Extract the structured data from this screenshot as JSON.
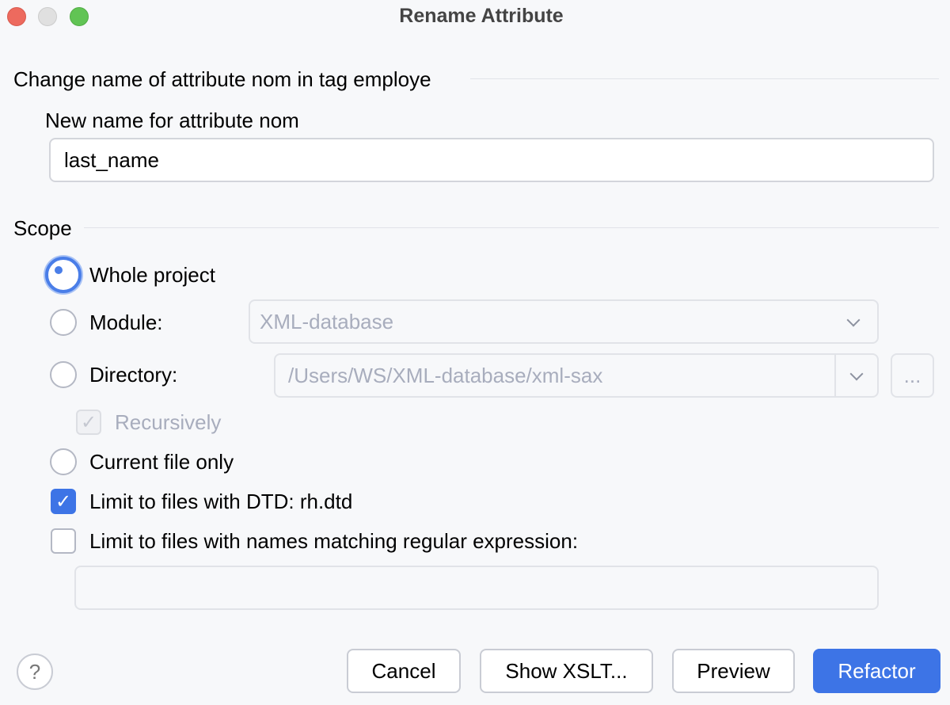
{
  "window": {
    "title": "Rename Attribute"
  },
  "header": {
    "section_title": "Change name of attribute nom in tag employe"
  },
  "name_field": {
    "label": "New name for attribute nom",
    "value": "last_name"
  },
  "scope": {
    "title": "Scope",
    "whole_project": "Whole project",
    "module": "Module:",
    "module_value": "XML-database",
    "directory": "Directory:",
    "directory_value": "/Users/WS/XML-database/xml-sax",
    "browse": "...",
    "recursively": "Recursively",
    "current_file": "Current file only",
    "limit_dtd": "Limit to files with DTD: rh.dtd",
    "limit_regex": "Limit to files with names matching regular expression:",
    "regex_value": ""
  },
  "buttons": {
    "help": "?",
    "cancel": "Cancel",
    "show_xslt": "Show XSLT...",
    "preview": "Preview",
    "refactor": "Refactor"
  }
}
